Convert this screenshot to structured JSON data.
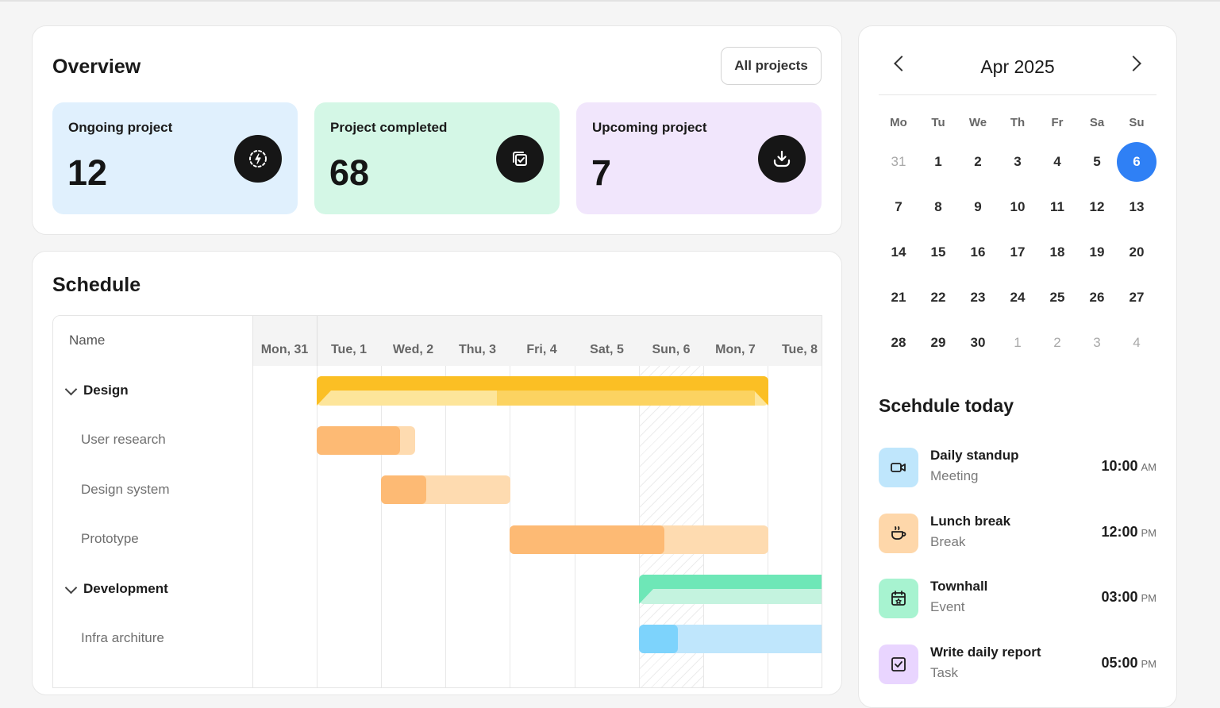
{
  "overview": {
    "title": "Overview",
    "all_projects_label": "All projects",
    "stats": [
      {
        "label": "Ongoing project",
        "value": "12",
        "icon": "lightning-circle-icon",
        "color": "#e0f0fd"
      },
      {
        "label": "Project completed",
        "value": "68",
        "icon": "copy-check-icon",
        "color": "#d4f7e6"
      },
      {
        "label": "Upcoming project",
        "value": "7",
        "icon": "download-icon",
        "color": "#f1e6fc"
      }
    ]
  },
  "schedule": {
    "title": "Schedule",
    "name_header": "Name",
    "days": [
      "Mon, 31",
      "Tue, 1",
      "Wed, 2",
      "Thu, 3",
      "Fri, 4",
      "Sat, 5",
      "Sun, 6",
      "Mon, 7",
      "Tue, 8"
    ],
    "weekend_day": "Sun, 6",
    "rows": [
      {
        "label": "Design",
        "group": true
      },
      {
        "label": "User research",
        "group": false
      },
      {
        "label": "Design system",
        "group": false
      },
      {
        "label": "Prototype",
        "group": false
      },
      {
        "label": "Development",
        "group": true
      },
      {
        "label": "Infra architure",
        "group": false
      }
    ],
    "colors": {
      "design_group": "#fbbf24",
      "design_group_light": "#fde59a",
      "design_task": "#fdba74",
      "design_task_light": "#fedbb0",
      "dev_group": "#6ee7b7",
      "dev_group_light": "#c4f3df",
      "dev_task": "#7dd3fc",
      "dev_task_light": "#bfe6fc"
    }
  },
  "calendar": {
    "month_label": "Apr 2025",
    "weekdays": [
      "Mo",
      "Tu",
      "We",
      "Th",
      "Fr",
      "Sa",
      "Su"
    ],
    "weeks": [
      [
        {
          "d": "31",
          "muted": true
        },
        {
          "d": "1"
        },
        {
          "d": "2"
        },
        {
          "d": "3"
        },
        {
          "d": "4"
        },
        {
          "d": "5"
        },
        {
          "d": "6",
          "selected": true
        }
      ],
      [
        {
          "d": "7"
        },
        {
          "d": "8"
        },
        {
          "d": "9"
        },
        {
          "d": "10"
        },
        {
          "d": "11"
        },
        {
          "d": "12"
        },
        {
          "d": "13"
        }
      ],
      [
        {
          "d": "14"
        },
        {
          "d": "15"
        },
        {
          "d": "16"
        },
        {
          "d": "17"
        },
        {
          "d": "18"
        },
        {
          "d": "19"
        },
        {
          "d": "20"
        }
      ],
      [
        {
          "d": "21"
        },
        {
          "d": "22"
        },
        {
          "d": "23"
        },
        {
          "d": "24"
        },
        {
          "d": "25"
        },
        {
          "d": "26"
        },
        {
          "d": "27"
        }
      ],
      [
        {
          "d": "28"
        },
        {
          "d": "29"
        },
        {
          "d": "30"
        },
        {
          "d": "1",
          "muted": true
        },
        {
          "d": "2",
          "muted": true
        },
        {
          "d": "3",
          "muted": true
        },
        {
          "d": "4",
          "muted": true
        }
      ]
    ],
    "selected_color": "#2f80f5"
  },
  "today": {
    "title": "Scehdule today",
    "events": [
      {
        "title": "Daily standup",
        "type": "Meeting",
        "time": "10:00",
        "ampm": "AM",
        "icon": "video-camera-icon",
        "color": "#bfe6fc"
      },
      {
        "title": "Lunch break",
        "type": "Break",
        "time": "12:00",
        "ampm": "PM",
        "icon": "coffee-cup-icon",
        "color": "#fed7aa"
      },
      {
        "title": "Townhall",
        "type": "Event",
        "time": "03:00",
        "ampm": "PM",
        "icon": "calendar-star-icon",
        "color": "#a7f3d0"
      },
      {
        "title": "Write daily report",
        "type": "Task",
        "time": "05:00",
        "ampm": "PM",
        "icon": "checkbox-icon",
        "color": "#e9d5ff"
      }
    ]
  }
}
